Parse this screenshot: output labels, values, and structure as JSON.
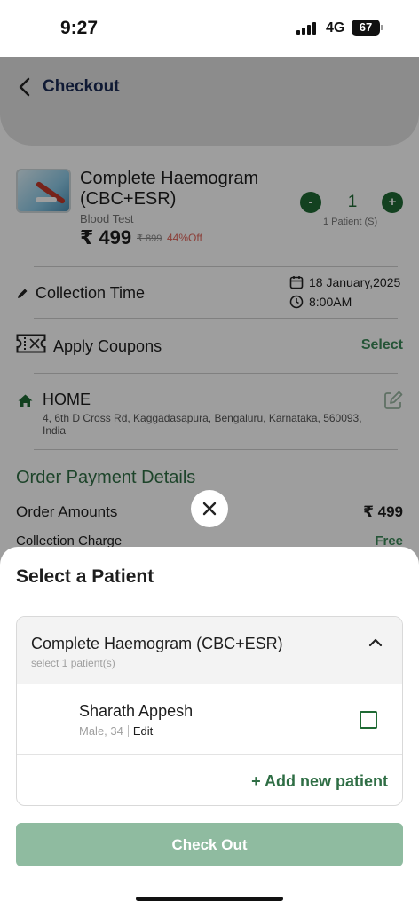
{
  "status_bar": {
    "time": "9:27",
    "network": "4G",
    "battery": "67"
  },
  "header": {
    "title": "Checkout"
  },
  "product": {
    "name": "Complete Haemogram (CBC+ESR)",
    "category": "Blood Test",
    "price": "₹ 499",
    "mrp": "₹ 899",
    "discount": "44%Off",
    "quantity": "1",
    "minus_label": "-",
    "plus_label": "+",
    "patients_label": "1 Patient (S)"
  },
  "collection": {
    "label": "Collection Time",
    "date": "18 January,2025",
    "time": "8:00AM"
  },
  "coupon": {
    "label": "Apply Coupons",
    "action": "Select"
  },
  "address": {
    "label": "HOME",
    "text": "4, 6th D Cross Rd, Kaggadasapura, Bengaluru, Karnataka, 560093, India"
  },
  "payment": {
    "title": "Order Payment Details",
    "order_amount_label": "Order Amounts",
    "order_amount_value": "₹ 499",
    "collection_charge_label": "Collection Charge",
    "collection_charge_value": "Free"
  },
  "sheet": {
    "title": "Select a Patient",
    "test_name": "Complete Haemogram (CBC+ESR)",
    "test_sub": "select 1 patient(s)",
    "patients": [
      {
        "name": "Sharath Appesh",
        "meta": "Male, 34",
        "edit": "Edit",
        "checked": false
      }
    ],
    "add_patient": "+ Add new patient",
    "checkout": "Check Out"
  },
  "colors": {
    "primary_green": "#1f6a34",
    "accent_green": "#3d8a5a",
    "discount_red": "#e0645a",
    "checkout_disabled": "#8fbba0"
  },
  "icons": [
    "back-icon",
    "pencil-icon",
    "calendar-icon",
    "clock-icon",
    "coupon-icon",
    "home-icon",
    "edit-address-icon",
    "close-icon",
    "chevron-up-icon",
    "checkbox"
  ]
}
